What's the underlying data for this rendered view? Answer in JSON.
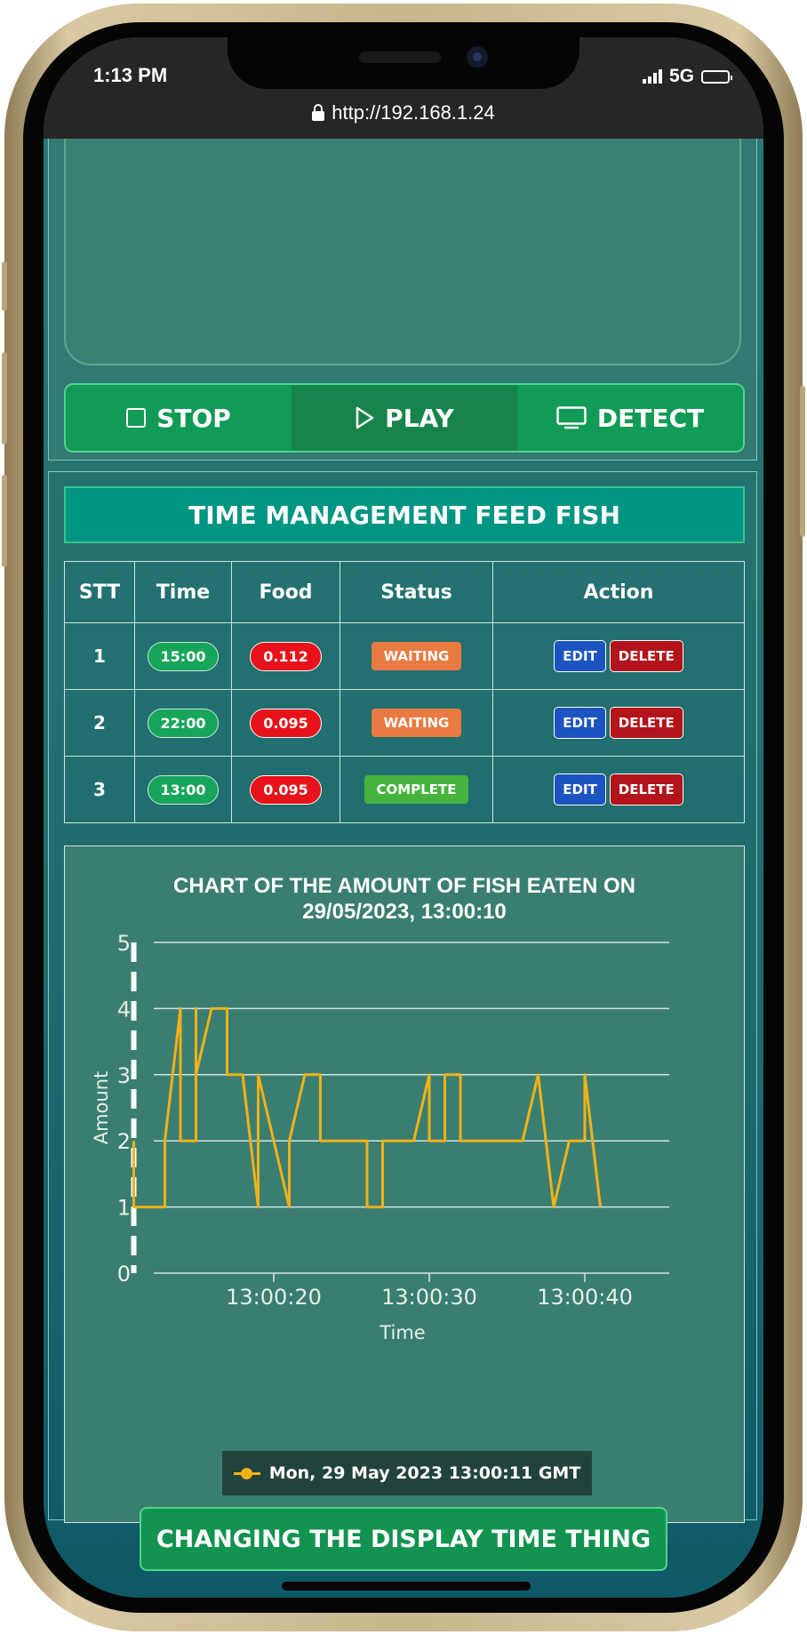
{
  "status": {
    "time": "1:13 PM",
    "network": "5G",
    "url": "http://192.168.1.24"
  },
  "controls": [
    {
      "label": "STOP",
      "icon": "stop-square-icon"
    },
    {
      "label": "PLAY",
      "icon": "play-icon"
    },
    {
      "label": "DETECT",
      "icon": "monitor-icon"
    }
  ],
  "schedule": {
    "title": "TIME MANAGEMENT FEED FISH",
    "headers": [
      "STT",
      "Time",
      "Food",
      "Status",
      "Action"
    ],
    "rows": [
      {
        "stt": "1",
        "time": "15:00",
        "food": "0.112",
        "status": "WAITING"
      },
      {
        "stt": "2",
        "time": "22:00",
        "food": "0.095",
        "status": "WAITING"
      },
      {
        "stt": "3",
        "time": "13:00",
        "food": "0.095",
        "status": "COMPLETE"
      }
    ],
    "edit_label": "EDIT",
    "delete_label": "DELETE"
  },
  "chart_data": {
    "type": "line",
    "title_line1": "CHART OF THE AMOUNT OF FISH EATEN ON",
    "title_line2": "29/05/2023, 13:00:10",
    "xlabel": "Time",
    "ylabel": "Amount",
    "ylim": [
      0,
      5
    ],
    "yticks": [
      "0",
      "1",
      "2",
      "3",
      "4",
      "5"
    ],
    "xticks": [
      "13:00:20",
      "13:00:30",
      "13:00:40"
    ],
    "cursor_x": "13:00:11",
    "series": [
      {
        "name": "Mon, 29 May 2023 13:00:11 GMT",
        "color": "#f2b118",
        "x": [
          "13:00:11",
          "13:00:11",
          "13:00:13",
          "13:00:13",
          "13:00:14",
          "13:00:14",
          "13:00:15",
          "13:00:15",
          "13:00:15",
          "13:00:16",
          "13:00:17",
          "13:00:17",
          "13:00:18",
          "13:00:19",
          "13:00:19",
          "13:00:20",
          "13:00:21",
          "13:00:21",
          "13:00:22",
          "13:00:23",
          "13:00:23",
          "13:00:24",
          "13:00:24",
          "13:00:26",
          "13:00:26",
          "13:00:27",
          "13:00:27",
          "13:00:29",
          "13:00:30",
          "13:00:30",
          "13:00:31",
          "13:00:31",
          "13:00:32",
          "13:00:32",
          "13:00:36",
          "13:00:37",
          "13:00:38",
          "13:00:39",
          "13:00:40",
          "13:00:40",
          "13:00:41"
        ],
        "values": [
          2,
          1,
          1,
          2,
          4,
          2,
          2,
          4,
          3,
          4,
          4,
          3,
          3,
          1,
          3,
          2,
          1,
          2,
          3,
          3,
          2,
          2,
          2,
          2,
          1,
          1,
          2,
          2,
          3,
          2,
          2,
          3,
          3,
          2,
          2,
          3,
          1,
          2,
          2,
          3,
          1
        ]
      }
    ]
  },
  "change_button": "CHANGING THE DISPLAY TIME THING",
  "colors": {
    "accent_green": "#129a57",
    "teal": "#009582",
    "line": "#f2b118",
    "waiting": "#e87a42",
    "complete": "#45b33c",
    "edit": "#1c54c1",
    "delete": "#b3131a"
  }
}
